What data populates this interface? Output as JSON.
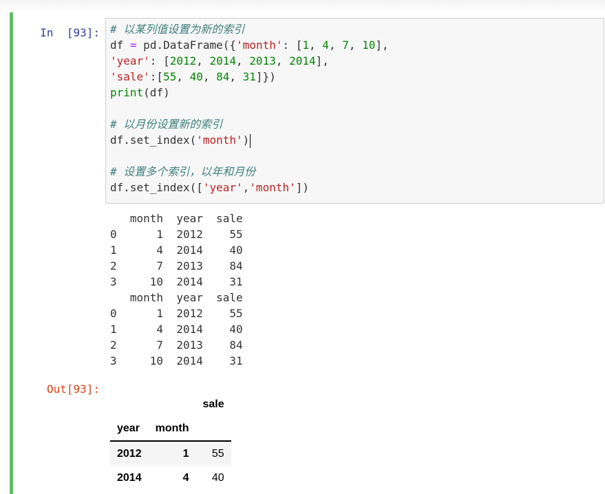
{
  "in_prompt": "In  [93]:",
  "out_prompt": "Out[93]:",
  "code_lines": [
    [
      {
        "t": "# 以某列值设置为新的索引",
        "c": "cm"
      }
    ],
    [
      {
        "t": "df ",
        "c": ""
      },
      {
        "t": "=",
        "c": "op"
      },
      {
        "t": " pd.DataFrame({",
        "c": ""
      },
      {
        "t": "'month'",
        "c": "str"
      },
      {
        "t": ": [",
        "c": ""
      },
      {
        "t": "1",
        "c": "num"
      },
      {
        "t": ", ",
        "c": ""
      },
      {
        "t": "4",
        "c": "num"
      },
      {
        "t": ", ",
        "c": ""
      },
      {
        "t": "7",
        "c": "num"
      },
      {
        "t": ", ",
        "c": ""
      },
      {
        "t": "10",
        "c": "num"
      },
      {
        "t": "],",
        "c": ""
      }
    ],
    [
      {
        "t": "'year'",
        "c": "str"
      },
      {
        "t": ": [",
        "c": ""
      },
      {
        "t": "2012",
        "c": "num"
      },
      {
        "t": ", ",
        "c": ""
      },
      {
        "t": "2014",
        "c": "num"
      },
      {
        "t": ", ",
        "c": ""
      },
      {
        "t": "2013",
        "c": "num"
      },
      {
        "t": ", ",
        "c": ""
      },
      {
        "t": "2014",
        "c": "num"
      },
      {
        "t": "],",
        "c": ""
      }
    ],
    [
      {
        "t": "'sale'",
        "c": "str"
      },
      {
        "t": ":[",
        "c": ""
      },
      {
        "t": "55",
        "c": "num"
      },
      {
        "t": ", ",
        "c": ""
      },
      {
        "t": "40",
        "c": "num"
      },
      {
        "t": ", ",
        "c": ""
      },
      {
        "t": "84",
        "c": "num"
      },
      {
        "t": ", ",
        "c": ""
      },
      {
        "t": "31",
        "c": "num"
      },
      {
        "t": "]})",
        "c": ""
      }
    ],
    [
      {
        "t": "print",
        "c": "num"
      },
      {
        "t": "(df)",
        "c": ""
      }
    ],
    [],
    [
      {
        "t": "# 以月份设置新的索引",
        "c": "cm"
      }
    ],
    [
      {
        "t": "df.set_index(",
        "c": ""
      },
      {
        "t": "'month'",
        "c": "str"
      },
      {
        "t": ")",
        "c": ""
      }
    ],
    [],
    [
      {
        "t": "# 设置多个索引，以年和月份",
        "c": "cm"
      }
    ],
    [
      {
        "t": "df.set_index([",
        "c": ""
      },
      {
        "t": "'year'",
        "c": "str"
      },
      {
        "t": ",",
        "c": ""
      },
      {
        "t": "'month'",
        "c": "str"
      },
      {
        "t": "])",
        "c": ""
      }
    ]
  ],
  "stream_output": [
    "   month  year  sale",
    "0      1  2012    55",
    "1      4  2014    40",
    "2      7  2013    84",
    "3     10  2014    31",
    "   month  year  sale",
    "0      1  2012    55",
    "1      4  2014    40",
    "2      7  2013    84",
    "3     10  2014    31"
  ],
  "table": {
    "value_header": "sale",
    "index_headers": [
      "year",
      "month"
    ],
    "rows": [
      {
        "year": "2012",
        "month": "1",
        "sale": "55"
      },
      {
        "year": "2014",
        "month": "4",
        "sale": "40"
      }
    ]
  },
  "colors": {
    "cell_border": "#66bb6a",
    "in_prompt": "#303f9f",
    "out_prompt": "#d84315"
  }
}
